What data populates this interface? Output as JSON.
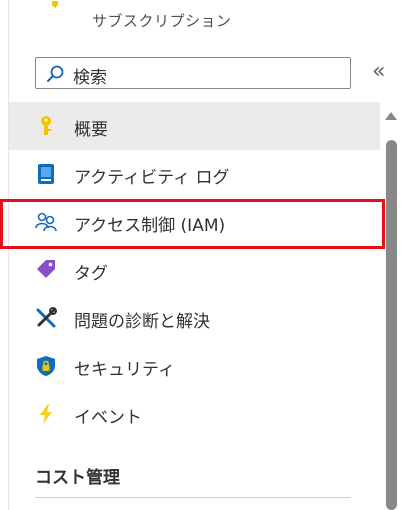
{
  "header": {
    "subtitle": "サブスクリプション",
    "subscription_icon": "key-icon"
  },
  "search": {
    "placeholder": "検索",
    "icon": "search-icon"
  },
  "collapse": {
    "label": "«",
    "icon": "double-chevron-left-icon"
  },
  "nav": {
    "items": [
      {
        "label": "概要",
        "icon": "key-icon",
        "selected": true
      },
      {
        "label": "アクティビティ ログ",
        "icon": "activity-log-icon",
        "selected": false
      },
      {
        "label": "アクセス制御 (IAM)",
        "icon": "people-icon",
        "selected": false,
        "highlighted": true
      },
      {
        "label": "タグ",
        "icon": "tag-icon",
        "selected": false
      },
      {
        "label": "問題の診断と解決",
        "icon": "wrench-icon",
        "selected": false
      },
      {
        "label": "セキュリティ",
        "icon": "shield-icon",
        "selected": false
      },
      {
        "label": "イベント",
        "icon": "lightning-icon",
        "selected": false
      }
    ]
  },
  "section": {
    "title": "コスト管理"
  },
  "colors": {
    "highlight_border": "#e3121a",
    "selected_bg": "#edebe9",
    "key_yellow": "#f5c400",
    "log_blue": "#0f6cbd",
    "tag_purple": "#8a4fc8",
    "lightning_yellow": "#f7d21c"
  }
}
